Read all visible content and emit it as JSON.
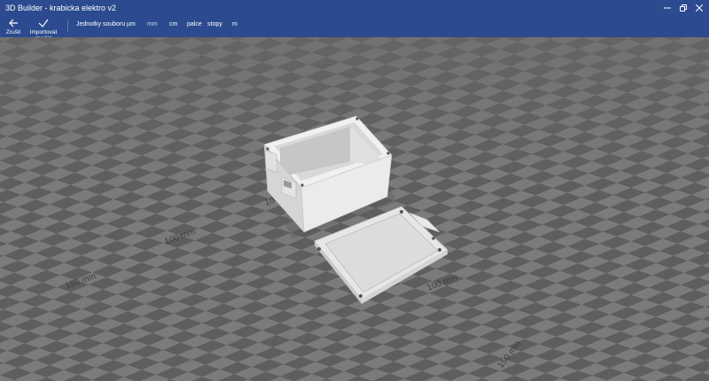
{
  "window": {
    "title": "3D Builder - krabicka elektro v2"
  },
  "toolbar": {
    "cancel_label": "Zrušit",
    "import_label": "Importovat model",
    "file_units_label": "Jednotky souboru",
    "units": [
      "µm",
      "mm",
      "cm",
      "palce",
      "stopy",
      "m"
    ],
    "selected_unit": "mm"
  },
  "scene": {
    "rulers": [
      "100 mm",
      "150 mm",
      "100 mm",
      "150 mm"
    ]
  },
  "colors": {
    "accent": "#2b4a8f",
    "model": "#e6e6e6",
    "floor_light": "#7b7b7b",
    "floor_dark": "#5e5e5e"
  }
}
